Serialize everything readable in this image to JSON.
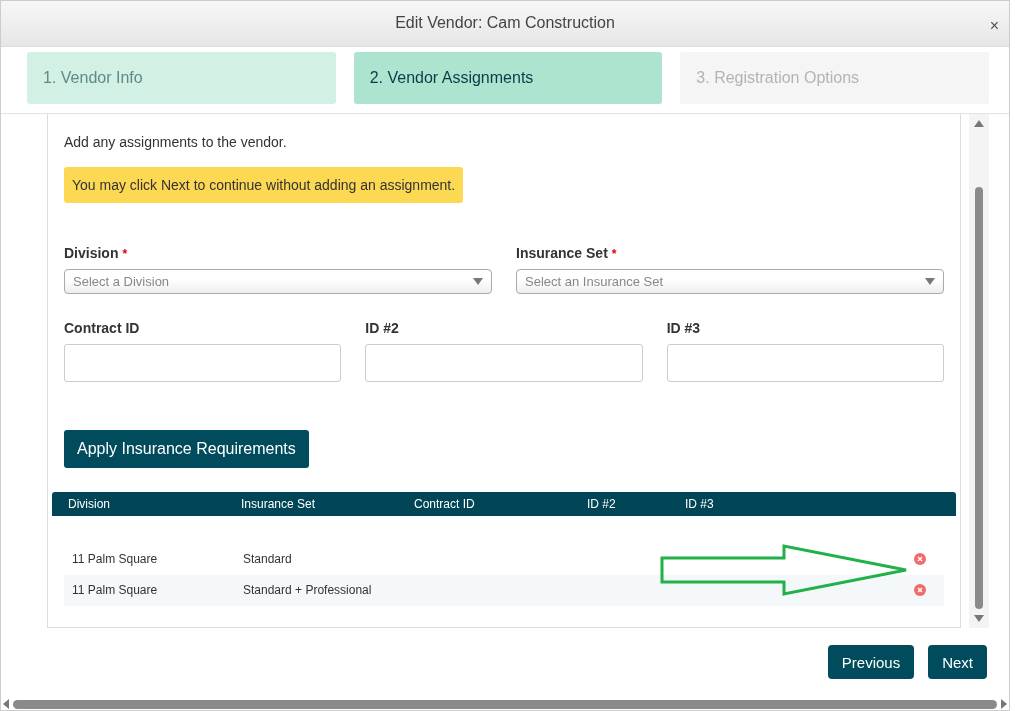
{
  "window": {
    "title": "Edit Vendor: Cam Construction",
    "close": "×"
  },
  "steps": [
    {
      "label": "1. Vendor Info",
      "selected": false,
      "disabled": false
    },
    {
      "label": "2. Vendor Assignments",
      "selected": true,
      "disabled": false
    },
    {
      "label": "3. Registration Options",
      "selected": false,
      "disabled": true
    }
  ],
  "intro": "Add any assignments to the vendor.",
  "alert": "You may click Next to continue without adding an assignment.",
  "selects": [
    {
      "label": "Division",
      "required_mark": "*",
      "placeholder": "Select a Division"
    },
    {
      "label": "Insurance Set",
      "required_mark": "*",
      "placeholder": "Select an Insurance Set"
    }
  ],
  "inputs": [
    {
      "label": "Contract ID"
    },
    {
      "label": "ID #2"
    },
    {
      "label": "ID #3"
    }
  ],
  "apply_button": "Apply Insurance Requirements",
  "table": {
    "columns": [
      "Division",
      "Insurance Set",
      "Contract ID",
      "ID #2",
      "ID #3"
    ],
    "rows": [
      [
        "11 Palm Square",
        "Standard",
        "",
        "",
        ""
      ],
      [
        "11 Palm Square",
        "Standard + Professional",
        "",
        "",
        ""
      ]
    ]
  },
  "footer": {
    "buttons": [
      "Previous",
      "Next"
    ]
  }
}
